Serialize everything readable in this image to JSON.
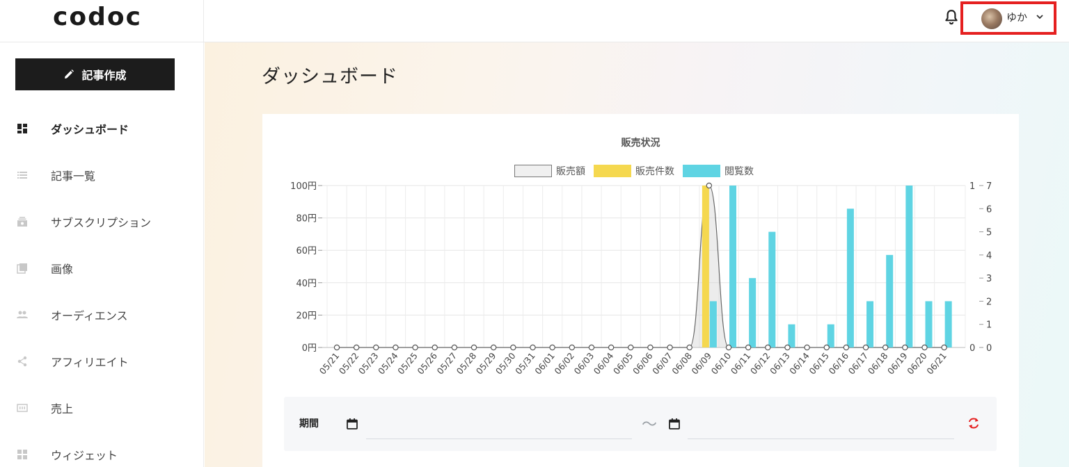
{
  "header": {
    "logo": "codoc",
    "user_name": "ゆか",
    "bell_icon": "bell-icon",
    "chevron_icon": "chevron-down-icon"
  },
  "sidebar": {
    "new_post_label": "記事作成",
    "items": [
      {
        "label": "ダッシュボード",
        "icon": "dashboard-icon",
        "active": true
      },
      {
        "label": "記事一覧",
        "icon": "list-icon",
        "active": false
      },
      {
        "label": "サブスクリプション",
        "icon": "subscription-icon",
        "active": false
      },
      {
        "label": "画像",
        "icon": "image-icon",
        "active": false
      },
      {
        "label": "オーディエンス",
        "icon": "audience-icon",
        "active": false
      },
      {
        "label": "アフィリエイト",
        "icon": "share-icon",
        "active": false
      },
      {
        "label": "売上",
        "icon": "sales-icon",
        "active": false
      },
      {
        "label": "ウィジェット",
        "icon": "widget-icon",
        "active": false
      }
    ]
  },
  "main": {
    "title": "ダッシュボード",
    "period": {
      "label": "期間",
      "start_value": "",
      "end_value": "",
      "separator": "〜"
    }
  },
  "colors": {
    "accent_dark": "#1c1c1c",
    "sales_amount": "#f0f0f0",
    "sales_count": "#f5d84f",
    "views": "#5fd4e3",
    "highlight_red": "#e52020"
  },
  "chart_data": {
    "type": "bar",
    "title": "販売状況",
    "categories": [
      "05/21",
      "05/22",
      "05/23",
      "05/24",
      "05/25",
      "05/26",
      "05/27",
      "05/28",
      "05/29",
      "05/30",
      "05/31",
      "06/01",
      "06/02",
      "06/03",
      "06/04",
      "06/05",
      "06/06",
      "06/07",
      "06/08",
      "06/09",
      "06/10",
      "06/11",
      "06/12",
      "06/13",
      "06/14",
      "06/15",
      "06/16",
      "06/17",
      "06/18",
      "06/19",
      "06/20",
      "06/21"
    ],
    "series": [
      {
        "name": "販売額",
        "type": "area",
        "axis": "left",
        "values": [
          0,
          0,
          0,
          0,
          0,
          0,
          0,
          0,
          0,
          0,
          0,
          0,
          0,
          0,
          0,
          0,
          0,
          0,
          0,
          100,
          0,
          0,
          0,
          0,
          0,
          0,
          0,
          0,
          0,
          0,
          0,
          0
        ]
      },
      {
        "name": "販売件数",
        "type": "bar",
        "axis": "right1",
        "values": [
          0,
          0,
          0,
          0,
          0,
          0,
          0,
          0,
          0,
          0,
          0,
          0,
          0,
          0,
          0,
          0,
          0,
          0,
          0,
          1,
          0,
          0,
          0,
          0,
          0,
          0,
          0,
          0,
          0,
          0,
          0,
          0
        ]
      },
      {
        "name": "閲覧数",
        "type": "bar",
        "axis": "right2",
        "values": [
          0,
          0,
          0,
          0,
          0,
          0,
          0,
          0,
          0,
          0,
          0,
          0,
          0,
          0,
          0,
          0,
          0,
          0,
          0,
          2,
          7,
          3,
          5,
          1,
          0,
          1,
          6,
          2,
          4,
          7,
          2,
          2
        ]
      }
    ],
    "y_left": {
      "ticks": [
        "0円",
        "20円",
        "40円",
        "60円",
        "80円",
        "100円"
      ],
      "range": [
        0,
        100
      ]
    },
    "y_right1": {
      "ticks": [
        "0",
        "1"
      ],
      "range": [
        0,
        1
      ]
    },
    "y_right2": {
      "ticks": [
        "0",
        "1",
        "2",
        "3",
        "4",
        "5",
        "6",
        "7"
      ],
      "range": [
        0,
        7
      ]
    },
    "grid": true,
    "legend_position": "top"
  }
}
